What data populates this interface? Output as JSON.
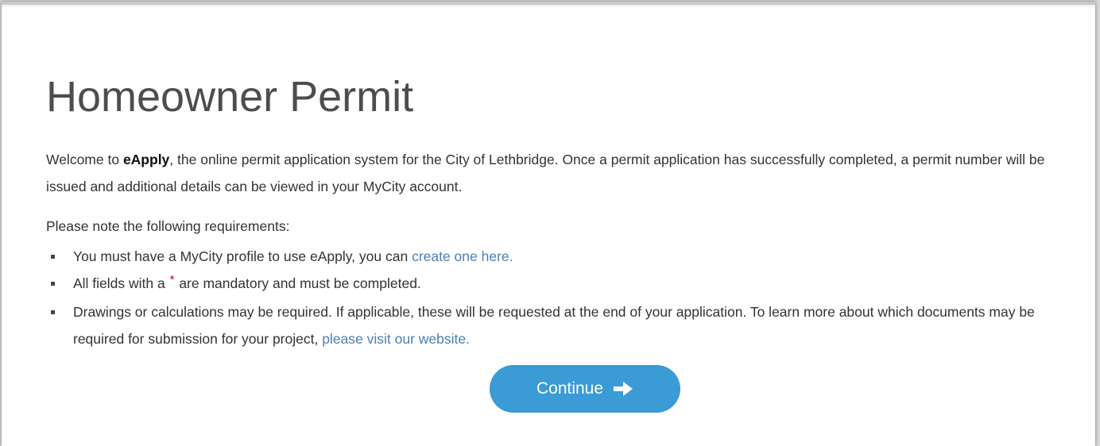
{
  "page": {
    "title": "Homeowner Permit",
    "intro": {
      "prefix": "Welcome to ",
      "brand": "eApply",
      "suffix": ", the online permit application system for the City of Lethbridge. Once a permit application has successfully completed, a permit number will be issued and additional details can be viewed in your MyCity account."
    },
    "requirements_heading": "Please note the following requirements:",
    "requirements": [
      {
        "text_before": "You must have a MyCity profile to use eApply, you can ",
        "link": "create one here."
      },
      {
        "text_before": "All fields with a ",
        "star": "*",
        "text_after": " are mandatory and must be completed."
      },
      {
        "text_before": "Drawings or calculations may be required. If applicable, these will be requested at the end of your application. To learn more about which documents may be required for submission for your project, ",
        "link": "please visit our website."
      }
    ],
    "continue_label": "Continue",
    "continue_icon": "arrow-right-icon"
  },
  "colors": {
    "accent": "#3a9bd5",
    "link": "#4a7fb5",
    "required": "#d0021b",
    "title": "#4d4d4d",
    "text": "#333333"
  }
}
